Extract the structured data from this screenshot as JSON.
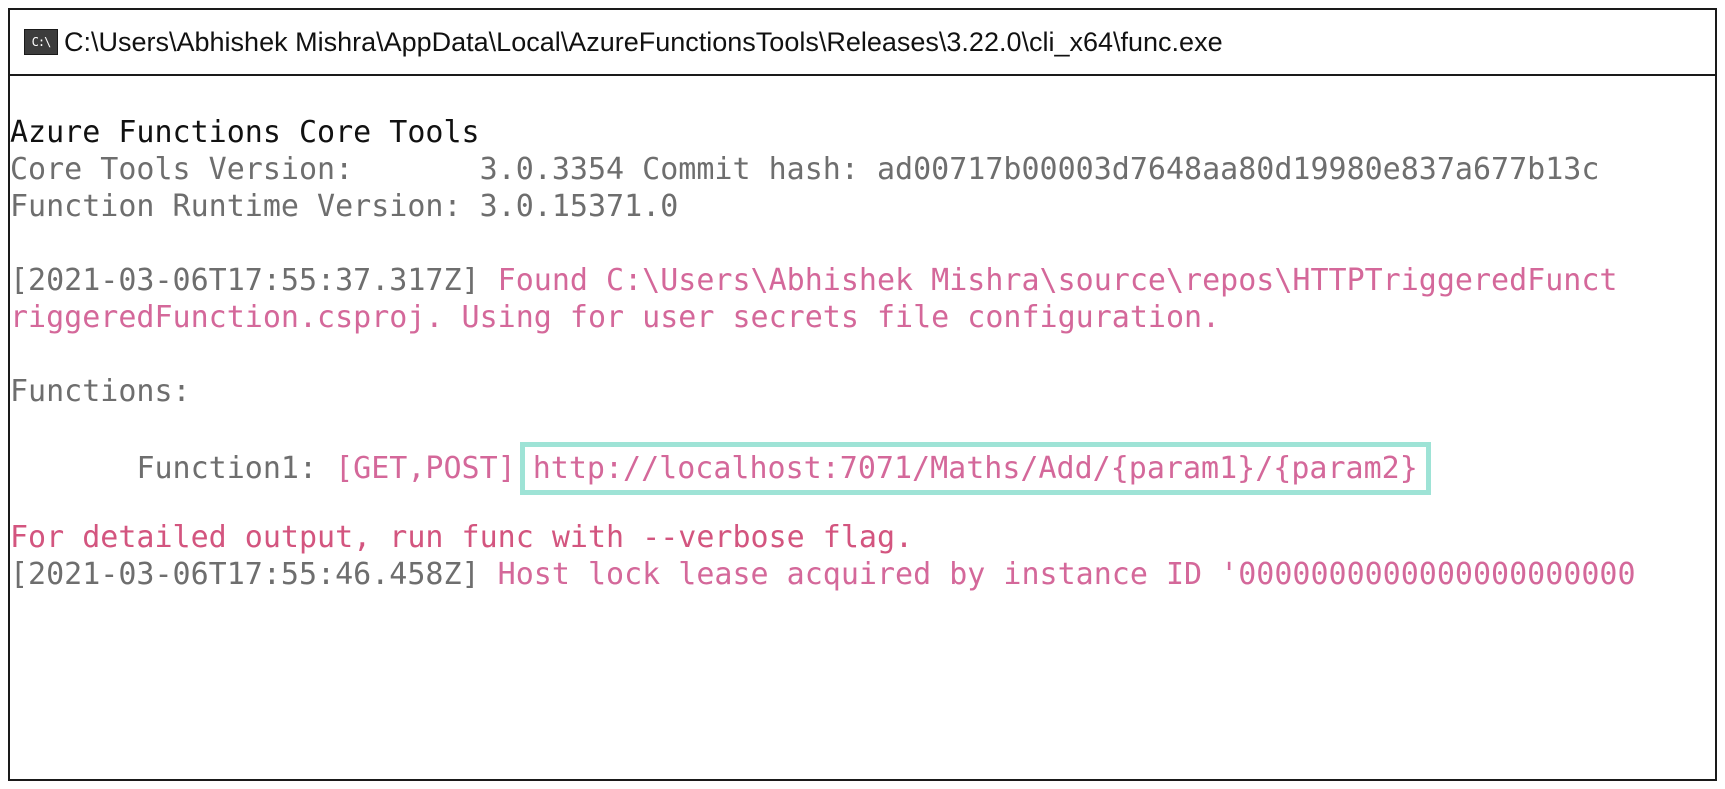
{
  "window": {
    "title": "C:\\Users\\Abhishek Mishra\\AppData\\Local\\AzureFunctionsTools\\Releases\\3.22.0\\cli_x64\\func.exe",
    "icon": "cmd-icon",
    "icon_text": "C:\\"
  },
  "console": {
    "header_title": "Azure Functions Core Tools",
    "core_tools_version_label": "Core Tools Version:       ",
    "core_tools_version_value": "3.0.3354 Commit hash: ad00717b00003d7648aa80d19980e837a677b13c",
    "runtime_version_label": "Function Runtime Version: ",
    "runtime_version_value": "3.0.15371.0",
    "log1_timestamp": "[2021-03-06T17:55:37.317Z]",
    "log1_message_line1": " Found C:\\Users\\Abhishek Mishra\\source\\repos\\HTTPTriggeredFunct",
    "log1_message_line2": "riggeredFunction.csproj. Using for user secrets file configuration.",
    "functions_heading": "Functions:",
    "function_indent": "       ",
    "function_name": "Function1:",
    "function_methods": " [GET,POST]",
    "function_url": "http://localhost:7071/Maths/Add/{param1}/{param2}",
    "verbose_hint": "For detailed output, run func with --verbose flag.",
    "log2_timestamp": "[2021-03-06T17:55:46.458Z]",
    "log2_message": " Host lock lease acquired by instance ID '0000000000000000000000"
  },
  "colors": {
    "text_default": "#111111",
    "text_gray": "#6e6e6e",
    "text_pink": "#d4689a",
    "text_red": "#d3557f",
    "highlight_box": "#9ee3d6"
  }
}
